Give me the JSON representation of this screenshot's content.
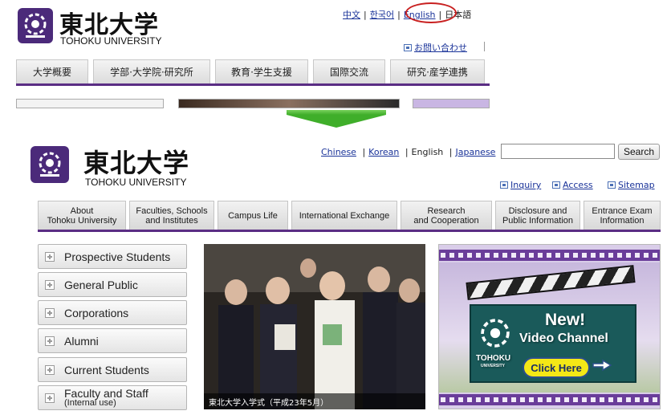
{
  "top": {
    "site_title": "東北大学",
    "site_subtitle": "TOHOKU UNIVERSITY",
    "logo_text": "東北大学",
    "languages": [
      "中文",
      "한국어",
      "English",
      "日本語"
    ],
    "contact_link": "お問い合わせ",
    "nav_tabs": [
      "大学概要",
      "学部·大学院·研究所",
      "教育·学生支援",
      "国際交流",
      "研究·産学連携"
    ]
  },
  "bottom": {
    "site_title": "東北大学",
    "site_subtitle": "TOHOKU UNIVERSITY",
    "logo_text": "東北大学",
    "languages": {
      "chinese": "Chinese",
      "korean": "Korean",
      "english": "English",
      "japanese": "Japanese"
    },
    "search": {
      "value": "",
      "button": "Search"
    },
    "utility_links": {
      "inquiry": "Inquiry",
      "access": "Access",
      "sitemap": "Sitemap"
    },
    "nav_tabs": [
      {
        "line1": "About",
        "line2": "Tohoku University"
      },
      {
        "line1": "Faculties, Schools",
        "line2": "and Institutes"
      },
      {
        "line1": "Campus Life",
        "line2": ""
      },
      {
        "line1": "International Exchange",
        "line2": ""
      },
      {
        "line1": "Research",
        "line2": "and Cooperation"
      },
      {
        "line1": "Disclosure and",
        "line2": "Public Information"
      },
      {
        "line1": "Entrance Exam",
        "line2": "Information"
      }
    ],
    "audience_menu": [
      {
        "label": "Prospective Students",
        "sub": ""
      },
      {
        "label": "General Public",
        "sub": ""
      },
      {
        "label": "Corporations",
        "sub": ""
      },
      {
        "label": "Alumni",
        "sub": ""
      },
      {
        "label": "Current Students",
        "sub": ""
      },
      {
        "label": "Faculty and Staff",
        "sub": "(Internal use)"
      }
    ],
    "photo_caption": "東北大学入学式（平成23年5月）",
    "video_banner": {
      "new": "New!",
      "channel": "Video Channel",
      "brand": "TOHOKU",
      "brand_sub": "UNIVERSITY",
      "cta": "Click Here"
    }
  },
  "colors": {
    "nav_line": "#5a2d84",
    "arrow": "#3fae2a",
    "highlight": "#c82020",
    "link": "#1a3399"
  }
}
